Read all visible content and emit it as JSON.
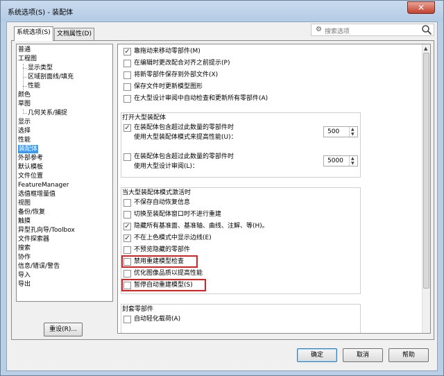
{
  "window": {
    "title": "系统选项(S) - 装配体",
    "close_label": "✕"
  },
  "tabs": [
    {
      "label": "系统选项(S)",
      "active": true
    },
    {
      "label": "文档属性(D)",
      "active": false
    }
  ],
  "search": {
    "placeholder": "搜索选项"
  },
  "tree": {
    "items": [
      {
        "label": "普通",
        "level": 0
      },
      {
        "label": "工程图",
        "level": 0
      },
      {
        "label": "显示类型",
        "level": 1
      },
      {
        "label": "区域剖面线/填充",
        "level": 1
      },
      {
        "label": "性能",
        "level": 1
      },
      {
        "label": "颜色",
        "level": 0
      },
      {
        "label": "草图",
        "level": 0
      },
      {
        "label": "几何关系/捕捉",
        "level": 1
      },
      {
        "label": "显示",
        "level": 0
      },
      {
        "label": "选择",
        "level": 0
      },
      {
        "label": "性能",
        "level": 0
      },
      {
        "label": "装配体",
        "level": 0,
        "selected": true
      },
      {
        "label": "外部参考",
        "level": 0
      },
      {
        "label": "默认模板",
        "level": 0
      },
      {
        "label": "文件位置",
        "level": 0
      },
      {
        "label": "FeatureManager",
        "level": 0
      },
      {
        "label": "选值框增量值",
        "level": 0
      },
      {
        "label": "视图",
        "level": 0
      },
      {
        "label": "备份/恢复",
        "level": 0
      },
      {
        "label": "触摸",
        "level": 0
      },
      {
        "label": "异型孔向导/Toolbox",
        "level": 0
      },
      {
        "label": "文件探索器",
        "level": 0
      },
      {
        "label": "搜索",
        "level": 0
      },
      {
        "label": "协作",
        "level": 0
      },
      {
        "label": "信息/错误/警告",
        "level": 0
      },
      {
        "label": "导入",
        "level": 0
      },
      {
        "label": "导出",
        "level": 0
      }
    ]
  },
  "reset_button": "重设(R)...",
  "options_top": [
    {
      "label": "靠拖动来移动零部件(M)",
      "checked": true
    },
    {
      "label": "在编辑时更改配合对齐之前提示(P)",
      "checked": false
    },
    {
      "label": "将新零部件保存到外部文件(X)",
      "checked": false
    },
    {
      "label": "保存文件时更新模型图形",
      "checked": false
    },
    {
      "label": "在大型设计审阅中自动检查和更新所有零部件(A)",
      "checked": false
    }
  ],
  "group_open_large": {
    "title": "打开大型装配体",
    "rows": [
      {
        "line1": "在装配体包含超过此数量的零部件时",
        "line2": "使用大型装配体模式来提高性能(U)：",
        "checked": true,
        "value": "500"
      },
      {
        "line1": "在装配体包含超过此数量的零部件时",
        "line2": "使用大型设计审阅(L)：",
        "checked": false,
        "value": "5000"
      }
    ]
  },
  "group_large_mode": {
    "title": "当大型装配体模式激活时",
    "options": [
      {
        "label": "不保存自动恢复信息",
        "checked": false
      },
      {
        "label": "切换至装配体窗口时不进行重建",
        "checked": false
      },
      {
        "label": "隐藏所有基准面、基准轴、曲线、注解、等(H)。",
        "checked": true
      },
      {
        "label": "不在上色模式中显示边线(E)",
        "checked": true
      },
      {
        "label": "不预览隐藏的零部件",
        "checked": false
      },
      {
        "label": "禁用重建模型检查",
        "checked": false
      },
      {
        "label": "优化图像品质以提高性能",
        "checked": false
      },
      {
        "label": "暂停自动重建模型(S)",
        "checked": false
      }
    ]
  },
  "group_envelope": {
    "title": "封套零部件",
    "options": [
      {
        "label": "自动轻化载荷(A)",
        "checked": false
      }
    ]
  },
  "footer": {
    "ok": "确定",
    "cancel": "取消",
    "help": "帮助"
  },
  "colors": {
    "highlight_border": "#e02020",
    "selection": "#3399ff"
  }
}
